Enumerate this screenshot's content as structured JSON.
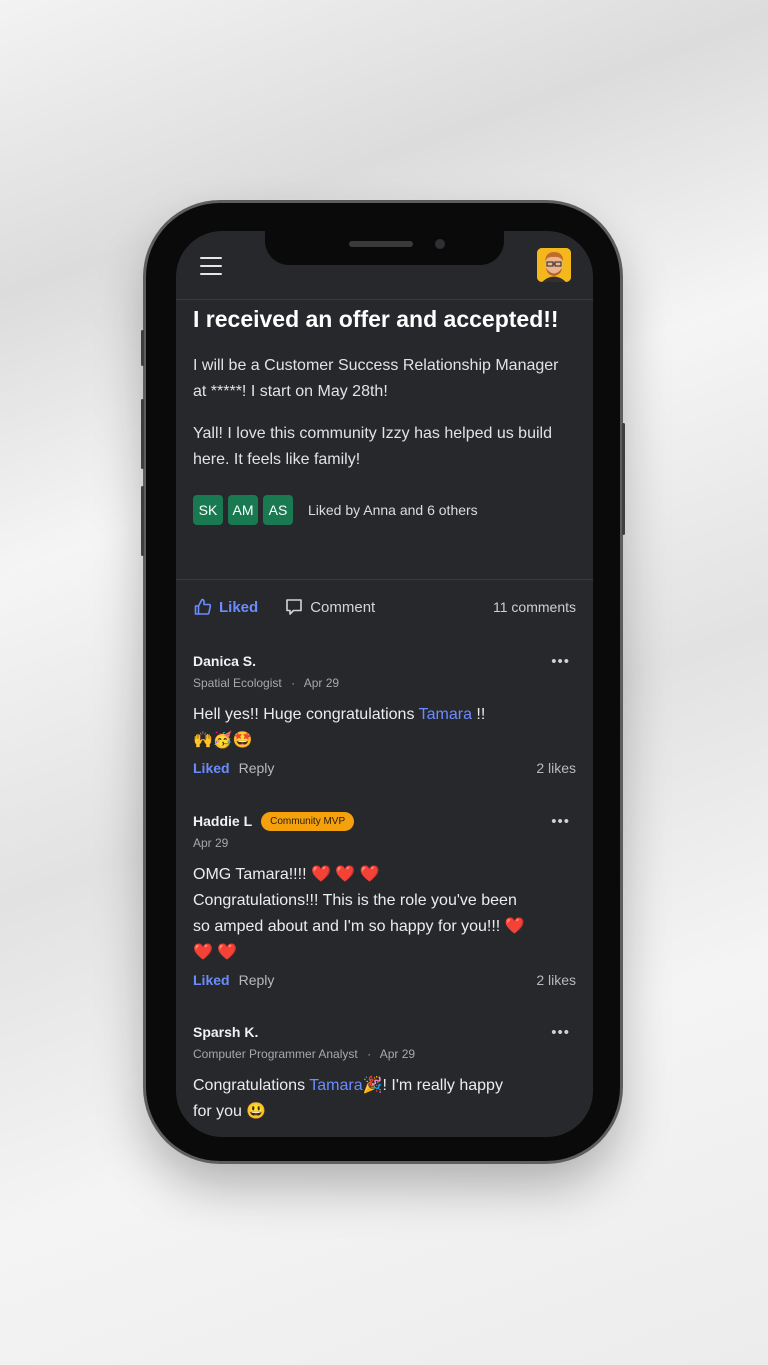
{
  "post": {
    "title": "I received an offer and accepted!!",
    "paragraph1": "I will be a Customer Success Relationship Manager at *****! I start on May 28th!",
    "paragraph2": "Yall! I love this community Izzy has helped us build here. It feels like family!",
    "liker_initials": [
      "SK",
      "AM",
      "AS"
    ],
    "liked_by": "Liked by Anna and 6 others"
  },
  "actions": {
    "like_label": "Liked",
    "comment_label": "Comment",
    "comments_count": "11 comments"
  },
  "comments": [
    {
      "author": "Danica S.",
      "role": "Spatial Ecologist",
      "date": "Apr 29",
      "text_before": "Hell yes!! Huge congratulations ",
      "mention": "Tamara",
      "text_after": " !!",
      "emoji_line": "🙌🥳🤩",
      "liked_label": "Liked",
      "reply_label": "Reply",
      "likes": "2 likes"
    },
    {
      "author": "Haddie L",
      "badge": "Community MVP",
      "date": "Apr 29",
      "line1": "OMG Tamara!!!! ❤️ ❤️ ❤️",
      "line2": "Congratulations!!! This is the role you've been so amped about and I'm so happy for you!!! ❤️ ❤️ ❤️",
      "liked_label": "Liked",
      "reply_label": "Reply",
      "likes": "2 likes"
    },
    {
      "author": "Sparsh K.",
      "role": "Computer Programmer Analyst",
      "date": "Apr 29",
      "text_before": "Congratulations ",
      "mention": "Tamara",
      "text_after": "🎉! I'm really happy for you 😃"
    }
  ],
  "meta_separator": "·",
  "more_glyph": "•••",
  "colors": {
    "accent": "#6b8cff",
    "screen_bg": "#27282c",
    "chip_bg": "#197a52",
    "badge_bg": "#f5a10d"
  },
  "icons": [
    "menu-icon",
    "user-avatar",
    "thumbs-up-icon",
    "comment-bubble-icon",
    "more-options-icon"
  ]
}
